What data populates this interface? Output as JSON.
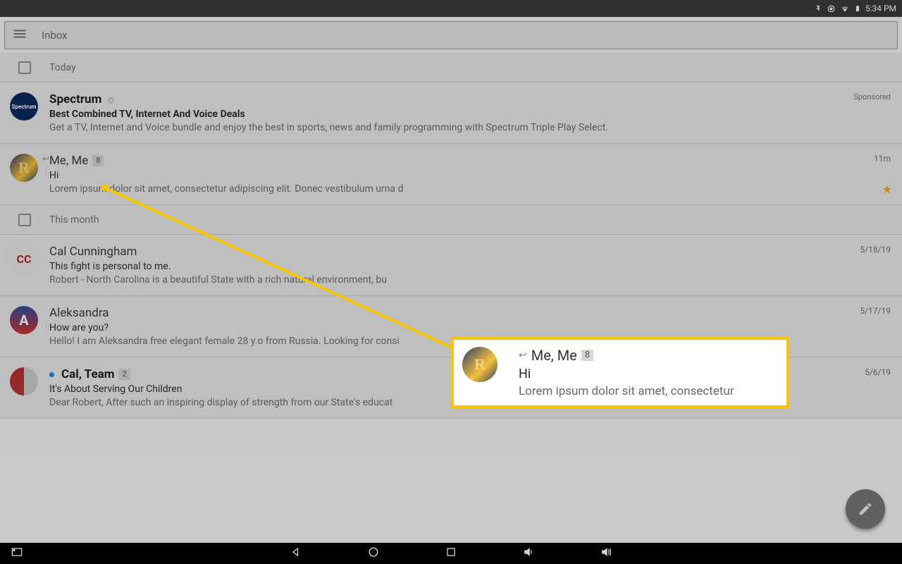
{
  "status": {
    "time": "5:34 PM"
  },
  "header": {
    "title": "Inbox"
  },
  "sections": {
    "today": "Today",
    "thismonth": "This month"
  },
  "emails": {
    "spectrum": {
      "sender": "Spectrum",
      "subject": "Best Combined TV, Internet And Voice Deals",
      "preview": "Get a TV, Internet and Voice bundle and enjoy the best in sports, news and family programming with Spectrum Triple Play Select.",
      "meta": "Sponsored"
    },
    "meme": {
      "sender": "Me, Me",
      "badge": "8",
      "subject": "Hi",
      "preview": "Lorem ipsum dolor sit amet, consectetur adipiscing elit. Donec vestibulum urna d",
      "meta": "11m"
    },
    "cal": {
      "sender": "Cal Cunningham",
      "subject": "This fight is personal to me.",
      "preview": "Robert - North Carolina is a beautiful State with a rich natural environment, bu",
      "meta": "5/18/19"
    },
    "aleks": {
      "sender": "Aleksandra",
      "subject": "How are you?",
      "preview": "Hello! I am Aleksandra free elegant female 28 y.o from Russia. Looking for consi",
      "meta": "5/17/19"
    },
    "calteam": {
      "sender": "Cal, Team",
      "badge": "2",
      "subject": "It's About Serving Our Children",
      "preview": "Dear Robert, After such an inspiring display of strength from our State's educat",
      "meta": "5/6/19"
    }
  },
  "callout": {
    "sender": "Me, Me",
    "badge": "8",
    "subject": "Hi",
    "preview": "Lorem ipsum dolor sit amet, consectetur"
  }
}
